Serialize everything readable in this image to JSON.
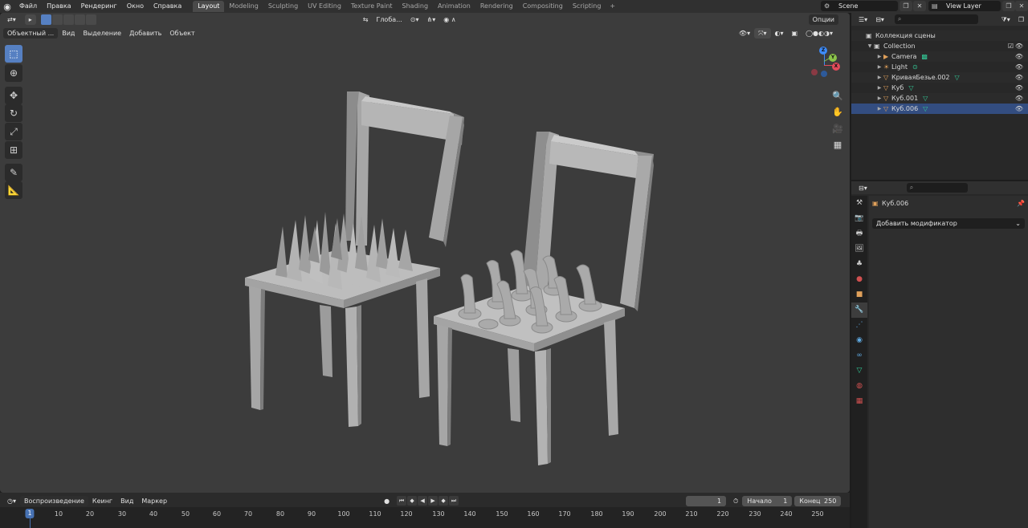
{
  "topbar": {
    "menus": [
      "Файл",
      "Правка",
      "Рендеринг",
      "Окно",
      "Справка"
    ],
    "workspaces": [
      "Layout",
      "Modeling",
      "Sculpting",
      "UV Editing",
      "Texture Paint",
      "Shading",
      "Animation",
      "Rendering",
      "Compositing",
      "Scripting"
    ],
    "active_workspace": "Layout",
    "add_tab": "+",
    "scene": "Scene",
    "view_layer": "View Layer"
  },
  "viewport": {
    "mode": "Объектный ...",
    "menus": [
      "Вид",
      "Выделение",
      "Добавить",
      "Объект"
    ],
    "orientation": "Глоба...",
    "options": "Опции"
  },
  "outliner": {
    "search_placeholder": "",
    "root": "Коллекция сцены",
    "collection": "Collection",
    "items": [
      {
        "name": "Camera",
        "type": "camera",
        "icon_color": "#e0a05a",
        "data_color": "#5fbf9f"
      },
      {
        "name": "Light",
        "type": "light",
        "icon_color": "#e0a05a",
        "data_color": "#5fbf9f"
      },
      {
        "name": "КриваяБезье.002",
        "type": "curve",
        "icon_color": "#e0a05a",
        "data_color": "#33cc99"
      },
      {
        "name": "Куб",
        "type": "mesh",
        "icon_color": "#e0a05a",
        "data_color": "#33cc99"
      },
      {
        "name": "Куб.001",
        "type": "mesh",
        "icon_color": "#e0a05a",
        "data_color": "#33cc99"
      },
      {
        "name": "Куб.006",
        "type": "mesh",
        "icon_color": "#e0a05a",
        "data_color": "#33cc99"
      }
    ]
  },
  "properties": {
    "object_name": "Куб.006",
    "add_modifier": "Добавить модификатор"
  },
  "timeline": {
    "menus": [
      "Воспроизведение",
      "Кеинг",
      "Вид",
      "Маркер"
    ],
    "current_frame": "1",
    "start_label": "Начало",
    "start_value": "1",
    "end_label": "Конец",
    "end_value": "250",
    "ruler_labels": [
      "10",
      "20",
      "30",
      "40",
      "50",
      "60",
      "70",
      "80",
      "90",
      "100",
      "110",
      "120",
      "130",
      "140",
      "150",
      "160",
      "170",
      "180",
      "190",
      "200",
      "210",
      "220",
      "230",
      "240",
      "250"
    ],
    "marker_label": "1"
  },
  "gizmo": {
    "x": "X",
    "y": "Y",
    "z": "Z"
  },
  "colors": {
    "accent": "#4772b3",
    "x_axis": "#e34b5a",
    "y_axis": "#8bc34a",
    "z_axis": "#3d8af7"
  }
}
